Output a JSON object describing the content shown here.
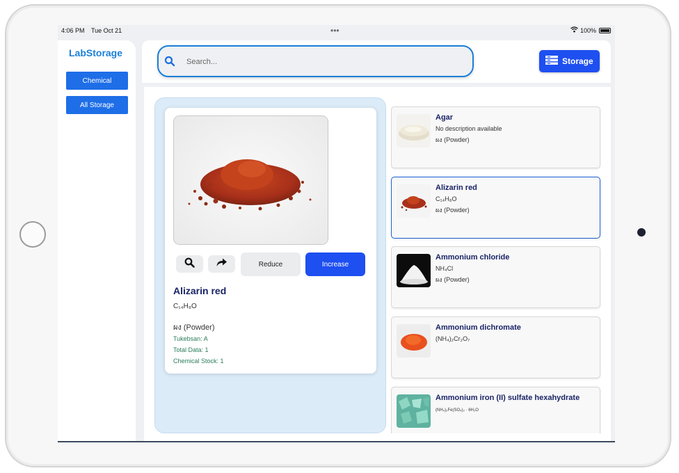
{
  "status_bar": {
    "time": "4:06 PM",
    "date": "Tue Oct 21",
    "dots": "•••",
    "battery": "100%"
  },
  "sidebar": {
    "brand": "LabStorage",
    "items": [
      {
        "label": "Chemical"
      },
      {
        "label": "All Storage"
      }
    ]
  },
  "search": {
    "placeholder": "Search...",
    "value": ""
  },
  "storage_button": {
    "label": "Storage"
  },
  "detail": {
    "name": "Alizarin red",
    "formula": "C₁₄H₈O",
    "state": "ผง (Powder)",
    "location": "Tukebsan: A",
    "total_data": "Total Data: 1",
    "chemical_stock": "Chemical Stock: 1",
    "reduce_label": "Reduce",
    "increase_label": "Increase"
  },
  "list": [
    {
      "name": "Agar",
      "sub": "No description available",
      "state": "ผง (Powder)",
      "thumb": "agar-powder"
    },
    {
      "name": "Alizarin red",
      "sub": "C₁₄H₈O",
      "state": "ผง (Powder)",
      "thumb": "red-powder",
      "selected": true
    },
    {
      "name": "Ammonium chloride",
      "sub": "NH₄Cl",
      "state": "ผง (Powder)",
      "thumb": "white-powder"
    },
    {
      "name": "Ammonium dichromate",
      "sub": "(NH₄)₂Cr₂O₇",
      "state": "",
      "thumb": "orange-powder"
    },
    {
      "name": "Ammonium iron (II) sulfate hexahydrate",
      "sub": "(NH₄)₂Fe(SO₄)₂ · 6H₂O",
      "state": "",
      "thumb": "green-crystals"
    }
  ],
  "colors": {
    "primary": "#1e4ff0",
    "brand": "#1a7fd8",
    "sidebar_button": "#1e6ee8",
    "name_text": "#1a2466",
    "meta_text": "#2b7d5a"
  }
}
